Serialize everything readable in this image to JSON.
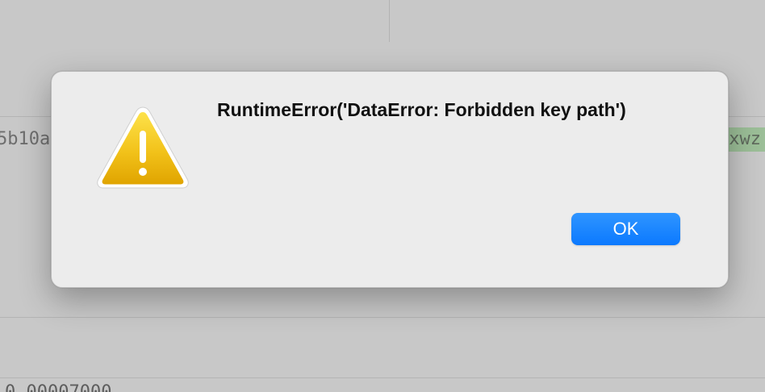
{
  "background": {
    "left_code_text": "5b10a",
    "right_code_text": "lxwz",
    "bottom_code_text": "    0.00007000",
    "right_code_highlight": "#9cbf98"
  },
  "dialog": {
    "icon": "warning-triangle-icon",
    "icon_color": "#f2c21a",
    "message": "RuntimeError('DataError: Forbidden key path')",
    "ok_label": "OK",
    "ok_color": "#0b79ff"
  }
}
